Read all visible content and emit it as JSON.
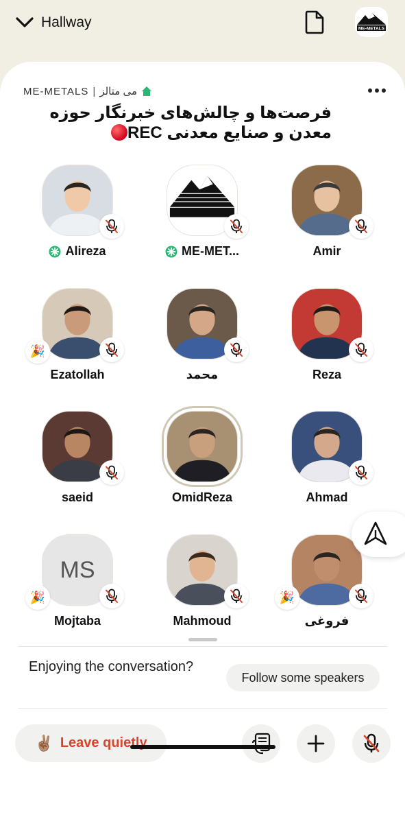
{
  "topbar": {
    "back_label": "Hallway",
    "icons": [
      "chevron-down-icon",
      "document-icon",
      "club-avatar"
    ]
  },
  "room": {
    "club_name": "ME-METALS",
    "club_sep": "|",
    "club_name_fa": "می متالز",
    "title": "فرصت‌ها و چالش‌های خبرنگار حوزه معدن و صنایع معدنی",
    "rec_label": "REC"
  },
  "speakers": [
    {
      "name": "Alireza",
      "moderator": true,
      "badge": "mute"
    },
    {
      "name": "ME-MET...",
      "moderator": true,
      "badge": "mute"
    },
    {
      "name": "Amir",
      "moderator": false,
      "badge": "mute"
    },
    {
      "name": "Ezatollah",
      "moderator": false,
      "badge": "mute",
      "party": true
    },
    {
      "name": "محمد",
      "moderator": false,
      "badge": "mute"
    },
    {
      "name": "Reza",
      "moderator": false,
      "badge": "mute"
    },
    {
      "name": "saeid",
      "moderator": false,
      "badge": "mute"
    },
    {
      "name": "OmidReza",
      "moderator": false,
      "badge": "none",
      "speaking": true
    },
    {
      "name": "Ahmad",
      "moderator": false,
      "badge": "mute"
    },
    {
      "name": "Mojtaba",
      "moderator": false,
      "badge": "mute",
      "party": true,
      "initials": "MS"
    },
    {
      "name": "Mahmoud",
      "moderator": false,
      "badge": "mute"
    },
    {
      "name": "فروغی",
      "moderator": false,
      "badge": "mute",
      "party": true
    }
  ],
  "footer": {
    "enjoy_text": "Enjoying the conversation?",
    "follow_label": "Follow some speakers",
    "leave_emoji": "✌🏽",
    "leave_label": "Leave quietly"
  },
  "colors": {
    "background": "#f1efe4",
    "leave": "#d6452a",
    "moderator": "#2bb673",
    "mute": "#d6452a"
  }
}
